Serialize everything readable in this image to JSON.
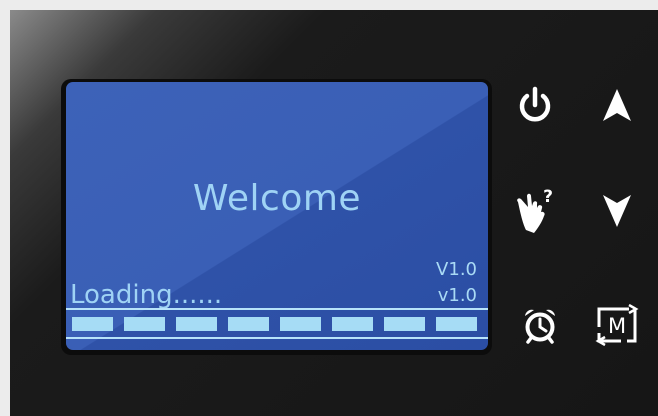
{
  "screen": {
    "welcome_text": "Welcome",
    "version_line_1": "V1.0",
    "version_line_2": "v1.0",
    "loading_text": "Loading......",
    "progress_segments_filled": 8,
    "progress_segments_total": 8
  },
  "buttons": [
    {
      "icon": "power-icon"
    },
    {
      "icon": "arrow-up-icon"
    },
    {
      "icon": "help-hand-icon"
    },
    {
      "icon": "arrow-down-icon"
    },
    {
      "icon": "alarm-clock-icon"
    },
    {
      "icon": "mode-cycle-icon",
      "label": "M"
    }
  ],
  "colors": {
    "lcd_background": "#3a5fb6",
    "lcd_text": "#9fd3f5",
    "device_body": "#1b1b1b",
    "icon_color": "#ffffff"
  }
}
